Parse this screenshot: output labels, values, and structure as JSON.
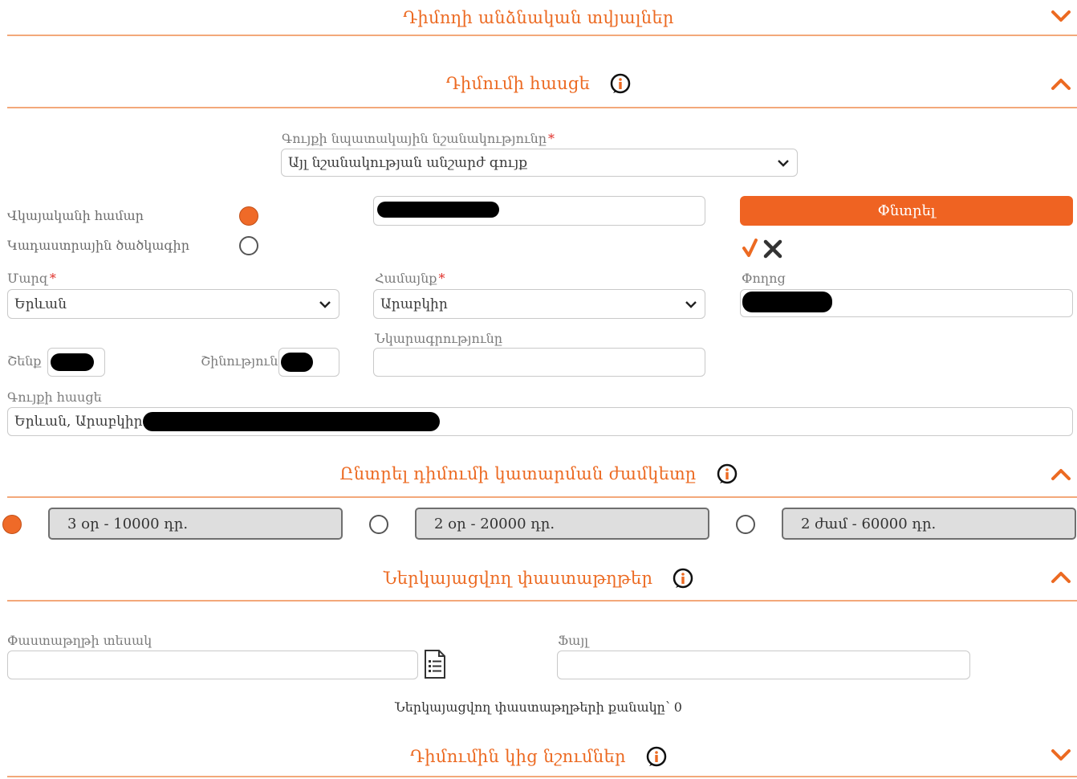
{
  "sections": {
    "personal": {
      "title": "Դիմողի անձնական տվյալներ"
    },
    "address": {
      "title": "Դիմումի հասցե"
    },
    "period": {
      "title": "Ընտրել դիմումի կատարման ժամկետը"
    },
    "documents": {
      "title": "Ներկայացվող փաստաթղթեր"
    },
    "notes": {
      "title": "Դիմումին կից նշումներ"
    }
  },
  "address": {
    "purpose_label": "Գույքի նպատակային նշանակությունը",
    "purpose_value": "Այլ նշանակության անշարժ գույք",
    "cert_number_label": "Վկայականի համար",
    "cadastral_code_label": "Կադաստրային ծածկագիր",
    "search_button": "Փնտրել",
    "marz_label": "Մարզ",
    "marz_value": "Երևան",
    "community_label": "Համայնք",
    "community_value": "Արաբկիր",
    "street_label": "Փողոց",
    "description_label": "Նկարագրությունը",
    "description_value": "",
    "building_label": "Շենք",
    "structure_label": "Շինություն",
    "full_address_label": "Գույքի հասցե",
    "full_address_value": "Երևան, Արաբկիր"
  },
  "period_options": [
    {
      "label": "3 օր - 10000 դր.",
      "selected": true
    },
    {
      "label": "2 օր - 20000 դր.",
      "selected": false
    },
    {
      "label": "2 ժամ - 60000 դր.",
      "selected": false
    }
  ],
  "documents": {
    "doc_type_label": "Փաստաթղթի տեսակ",
    "doc_type_value": "",
    "file_label": "Ֆայլ",
    "file_value": "",
    "count_label": "Ներկայացվող փաստաթղթերի քանակը՝ 0"
  },
  "colors": {
    "accent": "#ec6a22",
    "button": "#ef6322",
    "check": "#ec6a22"
  },
  "icons": [
    "info-icon",
    "chevron-down-icon",
    "chevron-up-icon",
    "check-icon",
    "x-icon",
    "document-list-icon",
    "caret-down-icon"
  ]
}
